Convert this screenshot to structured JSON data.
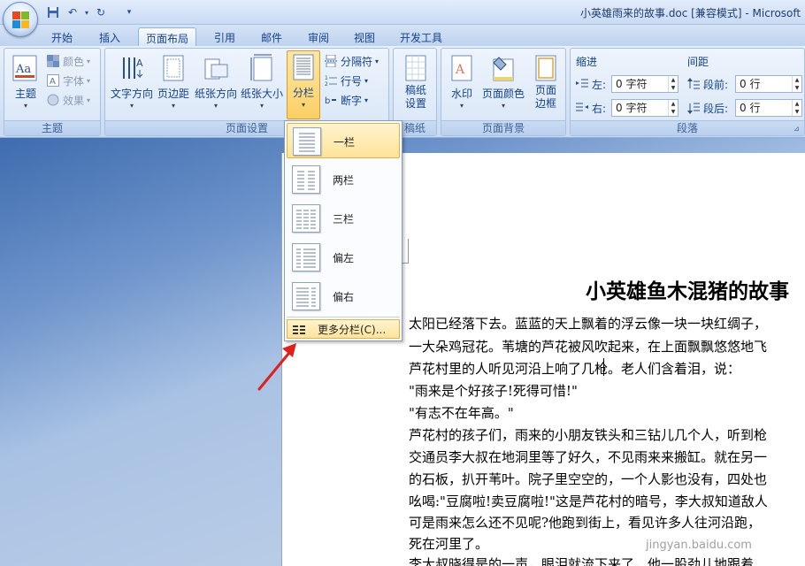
{
  "window": {
    "title": "小英雄雨来的故事.doc [兼容模式] - Microsoft"
  },
  "tabs": [
    {
      "label": "开始"
    },
    {
      "label": "插入"
    },
    {
      "label": "页面布局",
      "active": true
    },
    {
      "label": "引用"
    },
    {
      "label": "邮件"
    },
    {
      "label": "审阅"
    },
    {
      "label": "视图"
    },
    {
      "label": "开发工具"
    }
  ],
  "ribbon": {
    "theme": {
      "themes_label": "主题",
      "colors_label": "颜色",
      "fonts_label": "字体",
      "effects_label": "效果",
      "group_label": "主题"
    },
    "page_setup": {
      "text_direction": "文字方向",
      "margins": "页边距",
      "orientation": "纸张方向",
      "size": "纸张大小",
      "columns": "分栏",
      "breaks": "分隔符",
      "line_numbers": "行号",
      "hyphenation": "断字",
      "group_label": "页面设置"
    },
    "draft": {
      "draft_setting": "稿纸设置",
      "group_label": "稿纸"
    },
    "page_background": {
      "watermark": "水印",
      "page_color": "页面颜色",
      "page_borders": "页面边框",
      "group_label": "页面背景"
    },
    "paragraph": {
      "indent_label": "缩进",
      "spacing_label": "间距",
      "left_label": "左:",
      "left_value": "0 字符",
      "right_label": "右:",
      "right_value": "0 字符",
      "before_label": "段前:",
      "before_value": "0 行",
      "after_label": "段后:",
      "after_value": "0 行",
      "group_label": "段落"
    }
  },
  "columns_menu": {
    "options": [
      {
        "label": "一栏"
      },
      {
        "label": "两栏"
      },
      {
        "label": "三栏"
      },
      {
        "label": "偏左"
      },
      {
        "label": "偏右"
      }
    ],
    "more": "更多分栏(C)..."
  },
  "document": {
    "title": "小英雄鱼木混猪的故事",
    "lines": [
      "太阳已经落下去。蓝蓝的天上飘着的浮云像一块一块红绸子，",
      "一大朵鸡冠花。苇塘的芦花被风吹起来，在上面飘飘悠悠地飞",
      "芦花村里的人听见河沿上响了几枪。老人们含着泪，说：",
      "\"雨来是个好孩子!死得可惜!\"",
      "\"有志不在年高。\"",
      "芦花村的孩子们，雨来的小朋友铁头和三钻儿几个人，听到枪",
      "交通员李大叔在地洞里等了好久，不见雨来来搬缸。就在另一",
      "的石板，扒开苇叶。院子里空空的，一个人影也没有，四处也",
      "吆喝:\"豆腐啦!卖豆腐啦!\"这是芦花村的暗号，李大叔知道敌人",
      "可是雨来怎么还不见呢?他跑到街上，看见许多人往河沿跑，",
      "死在河里了。",
      "李大叔晓得是的一声，眼泪就流下来了，他一股劲儿地跟着"
    ]
  },
  "watermark": "jingyan.baidu.com",
  "colors": {
    "ribbon_text": "#15428b",
    "highlight": "#ffe39a",
    "arrow": "#e0201a"
  }
}
